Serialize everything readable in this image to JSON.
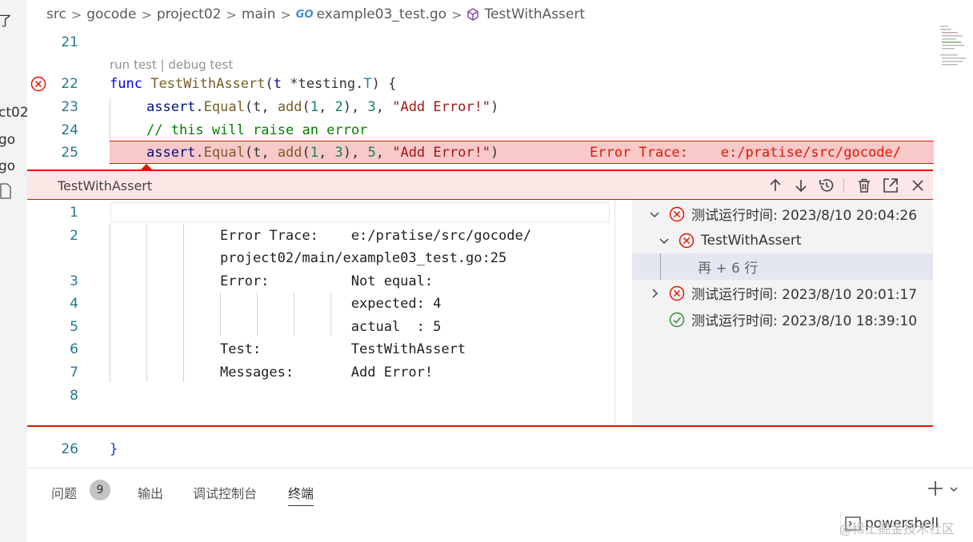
{
  "explorer": {
    "rows": [
      "了",
      "ct02",
      "go",
      "go"
    ]
  },
  "breadcrumb": {
    "items": [
      "src",
      "gocode",
      "project02",
      "main"
    ],
    "file_badge": "GO",
    "file_name": "example03_test.go",
    "symbol": "TestWithAssert"
  },
  "editor": {
    "codelens": "run test | debug test",
    "lines": [
      {
        "num": "21"
      },
      {
        "num": "22"
      },
      {
        "num": "23"
      },
      {
        "num": "24"
      },
      {
        "num": "25"
      }
    ],
    "line22": {
      "kw": "func",
      "name": "TestWithAssert",
      "param": "t",
      "type_ptr": "*testing.",
      "type": "T",
      "tail": ") {"
    },
    "line23": {
      "obj": "assert",
      "method": "Equal",
      "args_a": "(t, ",
      "fn": "add",
      "n1": "1",
      "n2": "2",
      "n3": "3",
      "str": "\"Add Error!\"",
      "close": ")"
    },
    "line24": {
      "comment": "// this will raise an error"
    },
    "line25": {
      "obj": "assert",
      "method": "Equal",
      "args_a": "(t, ",
      "fn": "add",
      "n1": "1",
      "n2": "3",
      "n3": "5",
      "str": "\"Add Error!\"",
      "close": ")",
      "inline_error": "Error Trace:    e:/pratise/src/gocode/"
    },
    "line26": {
      "num": "26",
      "text": "}"
    }
  },
  "peek": {
    "title": "TestWithAssert",
    "actions": [
      "arrow-up-icon",
      "arrow-down-icon",
      "history-icon",
      "trash-icon",
      "open-external-icon",
      "close-icon"
    ],
    "message_lines": [
      {
        "num": "1",
        "text": ""
      },
      {
        "num": "2",
        "text": "Error Trace:    e:/pratise/src/gocode/"
      },
      {
        "num": "",
        "text": "project02/main/example03_test.go:25"
      },
      {
        "num": "3",
        "text": "Error:          Not equal:"
      },
      {
        "num": "4",
        "text": "                expected: 4"
      },
      {
        "num": "5",
        "text": "                actual  : 5"
      },
      {
        "num": "6",
        "text": "Test:           TestWithAssert"
      },
      {
        "num": "7",
        "text": "Messages:       Add Error!"
      },
      {
        "num": "8",
        "text": ""
      }
    ],
    "tree": [
      {
        "label": "测试运行时间: 2023/8/10 20:04:26",
        "status": "failed",
        "expanded": true
      },
      {
        "label": "TestWithAssert",
        "status": "failed",
        "expanded": true
      },
      {
        "label": "再 + 6 行",
        "status": "none"
      },
      {
        "label": "测试运行时间: 2023/8/10 20:01:17",
        "status": "failed",
        "expanded": false
      },
      {
        "label": "测试运行时间: 2023/8/10 18:39:10",
        "status": "passed"
      }
    ]
  },
  "panel": {
    "tabs": [
      "问题",
      "输出",
      "调试控制台",
      "终端"
    ],
    "problem_count": "9",
    "active_tab": "终端",
    "terminal_name": "powershell"
  },
  "watermark": "@稀土掘金技术社区",
  "colors": {
    "error": "#e51400",
    "error_bg": "#f8c9c9",
    "line_number": "#237893",
    "passed": "#388a34"
  }
}
